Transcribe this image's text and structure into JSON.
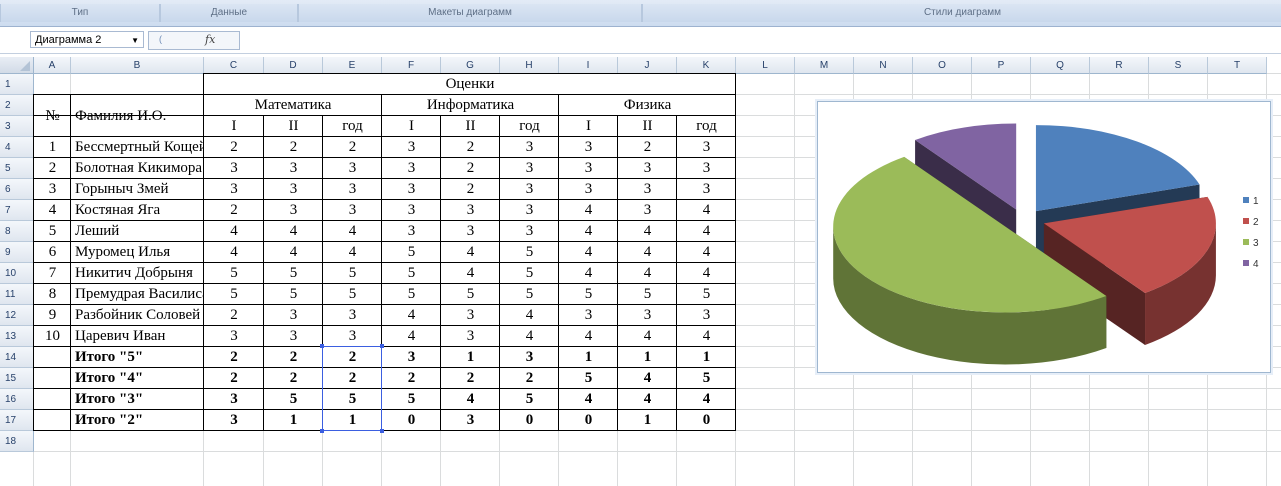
{
  "ribbon": {
    "groups": [
      {
        "label": "Тип"
      },
      {
        "label": "Данные"
      },
      {
        "label": "Макеты диаграмм"
      },
      {
        "label": "Стили диаграмм"
      }
    ]
  },
  "formula_bar": {
    "name_box": "Диаграмма 2",
    "fx_label": "fx",
    "formula": ""
  },
  "sheet": {
    "columns": [
      "A",
      "B",
      "C",
      "D",
      "E",
      "F",
      "G",
      "H",
      "I",
      "J",
      "K",
      "L",
      "M",
      "N",
      "O",
      "P",
      "Q",
      "R",
      "S",
      "T"
    ],
    "rows": [
      "1",
      "2",
      "3",
      "4",
      "5",
      "6",
      "7",
      "8",
      "9",
      "10",
      "11",
      "12",
      "13",
      "14",
      "15",
      "16",
      "17",
      "18"
    ],
    "header": {
      "grades": "Оценки",
      "num": "№",
      "name": "Фамилия И.О.",
      "subjects": [
        "Математика",
        "Информатика",
        "Физика"
      ],
      "terms": [
        "I",
        "II",
        "год"
      ]
    },
    "students": [
      {
        "n": "1",
        "name": "Бессмертный Кощей",
        "g": [
          "2",
          "2",
          "2",
          "3",
          "2",
          "3",
          "3",
          "2",
          "3"
        ]
      },
      {
        "n": "2",
        "name": "Болотная Кикимора",
        "g": [
          "3",
          "3",
          "3",
          "3",
          "2",
          "3",
          "3",
          "3",
          "3"
        ]
      },
      {
        "n": "3",
        "name": "Горыныч Змей",
        "g": [
          "3",
          "3",
          "3",
          "3",
          "2",
          "3",
          "3",
          "3",
          "3"
        ]
      },
      {
        "n": "4",
        "name": "Костяная Яга",
        "g": [
          "2",
          "3",
          "3",
          "3",
          "3",
          "3",
          "4",
          "3",
          "4"
        ]
      },
      {
        "n": "5",
        "name": "Леший",
        "g": [
          "4",
          "4",
          "4",
          "3",
          "3",
          "3",
          "4",
          "4",
          "4"
        ]
      },
      {
        "n": "6",
        "name": "Муромец Илья",
        "g": [
          "4",
          "4",
          "4",
          "5",
          "4",
          "5",
          "4",
          "4",
          "4"
        ]
      },
      {
        "n": "7",
        "name": "Никитич Добрыня",
        "g": [
          "5",
          "5",
          "5",
          "5",
          "4",
          "5",
          "4",
          "4",
          "4"
        ]
      },
      {
        "n": "8",
        "name": "Премудрая Василиса",
        "g": [
          "5",
          "5",
          "5",
          "5",
          "5",
          "5",
          "5",
          "5",
          "5"
        ]
      },
      {
        "n": "9",
        "name": "Разбойник Соловей",
        "g": [
          "2",
          "3",
          "3",
          "4",
          "3",
          "4",
          "3",
          "3",
          "3"
        ]
      },
      {
        "n": "10",
        "name": "Царевич Иван",
        "g": [
          "3",
          "3",
          "3",
          "4",
          "3",
          "4",
          "4",
          "4",
          "4"
        ]
      }
    ],
    "totals": [
      {
        "name": "Итого \"5\"",
        "g": [
          "2",
          "2",
          "2",
          "3",
          "1",
          "3",
          "1",
          "1",
          "1"
        ]
      },
      {
        "name": "Итого \"4\"",
        "g": [
          "2",
          "2",
          "2",
          "2",
          "2",
          "2",
          "5",
          "4",
          "5"
        ]
      },
      {
        "name": "Итого \"3\"",
        "g": [
          "3",
          "5",
          "5",
          "5",
          "4",
          "5",
          "4",
          "4",
          "4"
        ]
      },
      {
        "name": "Итого \"2\"",
        "g": [
          "3",
          "1",
          "1",
          "0",
          "3",
          "0",
          "0",
          "1",
          "0"
        ]
      }
    ]
  },
  "chart_data": {
    "type": "pie",
    "title": "",
    "categories": [
      "1",
      "2",
      "3",
      "4"
    ],
    "values": [
      2,
      2,
      5,
      1
    ],
    "colors": [
      "#4f81bd",
      "#c0504d",
      "#9bbb59",
      "#8064a2"
    ],
    "legend_position": "right",
    "exploded": true,
    "style": "3d"
  }
}
